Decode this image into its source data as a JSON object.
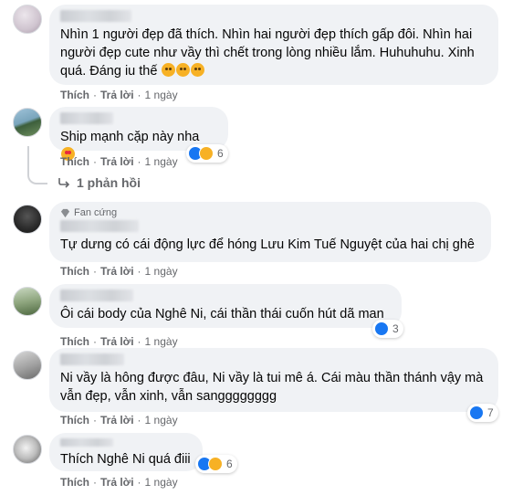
{
  "comments": [
    {
      "text": "Nhìn 1 người đẹp đã thích. Nhìn hai người đẹp thích gấp đôi. Nhìn hai người đẹp cute như vầy thì chết trong lòng nhiều lắm. Huhuhuhu. Xinh quá. Đáng iu thế",
      "like_label": "Thích",
      "reply_label": "Trả lời",
      "time": "1 ngày"
    },
    {
      "text": "Ship mạnh cặp này nha",
      "like_label": "Thích",
      "reply_label": "Trả lời",
      "time": "1 ngày",
      "reaction_count": "6"
    },
    {
      "badge": "Fan cứng",
      "text": "Tự dưng có cái động lực để hóng Lưu Kim Tuế Nguyệt của hai chị ghê",
      "like_label": "Thích",
      "reply_label": "Trả lời",
      "time": "1 ngày"
    },
    {
      "text": "Ôi cái body của Nghê Ni, cái thần thái cuốn hút dã man",
      "like_label": "Thích",
      "reply_label": "Trả lời",
      "time": "1 ngày",
      "reaction_count": "3"
    },
    {
      "text": "Ni vầy là hông được đâu, Ni vầy là tui mê á. Cái màu thần thánh vậy mà vẫn đẹp, vẫn xinh, vẫn sangggggggg",
      "like_label": "Thích",
      "reply_label": "Trả lời",
      "time": "1 ngày",
      "reaction_count": "7"
    },
    {
      "text": "Thích Nghê Ni quá điii",
      "like_label": "Thích",
      "reply_label": "Trả lời",
      "time": "1 ngày",
      "reaction_count": "6"
    }
  ],
  "view_replies": "1 phản hồi",
  "colors": {
    "bubble": "#f0f2f5",
    "meta": "#65676b",
    "like_blue": "#1877f2",
    "haha": "#f7b125"
  }
}
